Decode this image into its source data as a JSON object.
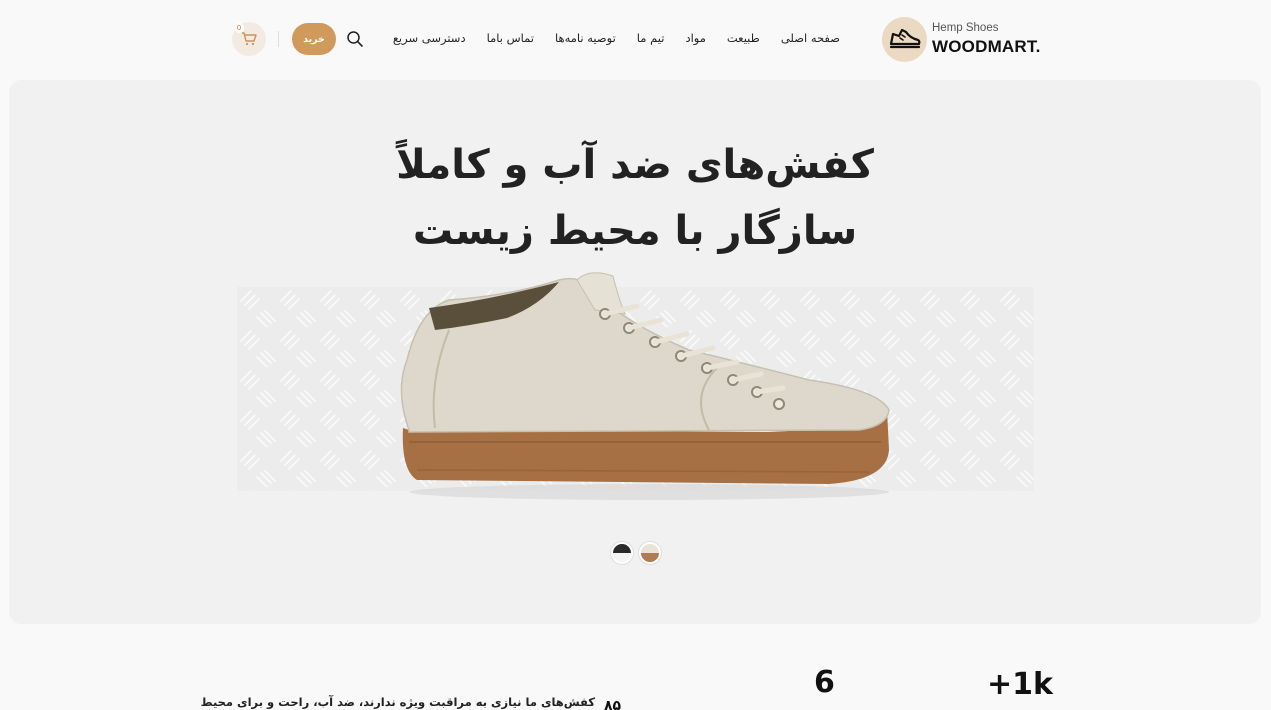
{
  "brand": {
    "small": "Hemp Shoes",
    "big": "WOODMART.",
    "accent": "#cf9a5c",
    "logo_bg": "#ecd9c3"
  },
  "nav": {
    "items": [
      {
        "label": "صفحه اصلی"
      },
      {
        "label": "طبیعت"
      },
      {
        "label": "مواد"
      },
      {
        "label": "تیم ما"
      },
      {
        "label": "توصیه نامه‌ها"
      },
      {
        "label": "تماس باما"
      },
      {
        "label": "دسترسی سریع"
      }
    ]
  },
  "tools": {
    "buy_label": "خرید",
    "cart_count": "0",
    "search_icon": "search-icon",
    "cart_icon": "cart-icon"
  },
  "hero": {
    "title_line1": "کفش‌های ضد آب و کاملاً",
    "title_line2": "سازگار با محیط زیست",
    "background": "#f1f1f1",
    "swatches": [
      {
        "top": "#2b2b2b",
        "bottom": "#f5f5f5"
      },
      {
        "top": "#ebe4d6",
        "bottom": "#b07a52"
      }
    ]
  },
  "stats": {
    "stat1": "+1k",
    "stat2": "6",
    "stat3_desc": "کفش‌های ما نیازی به مراقبت ویژه ندارند، ضد آب، راحت و برای محیط",
    "stat3_num": "۸۵"
  }
}
